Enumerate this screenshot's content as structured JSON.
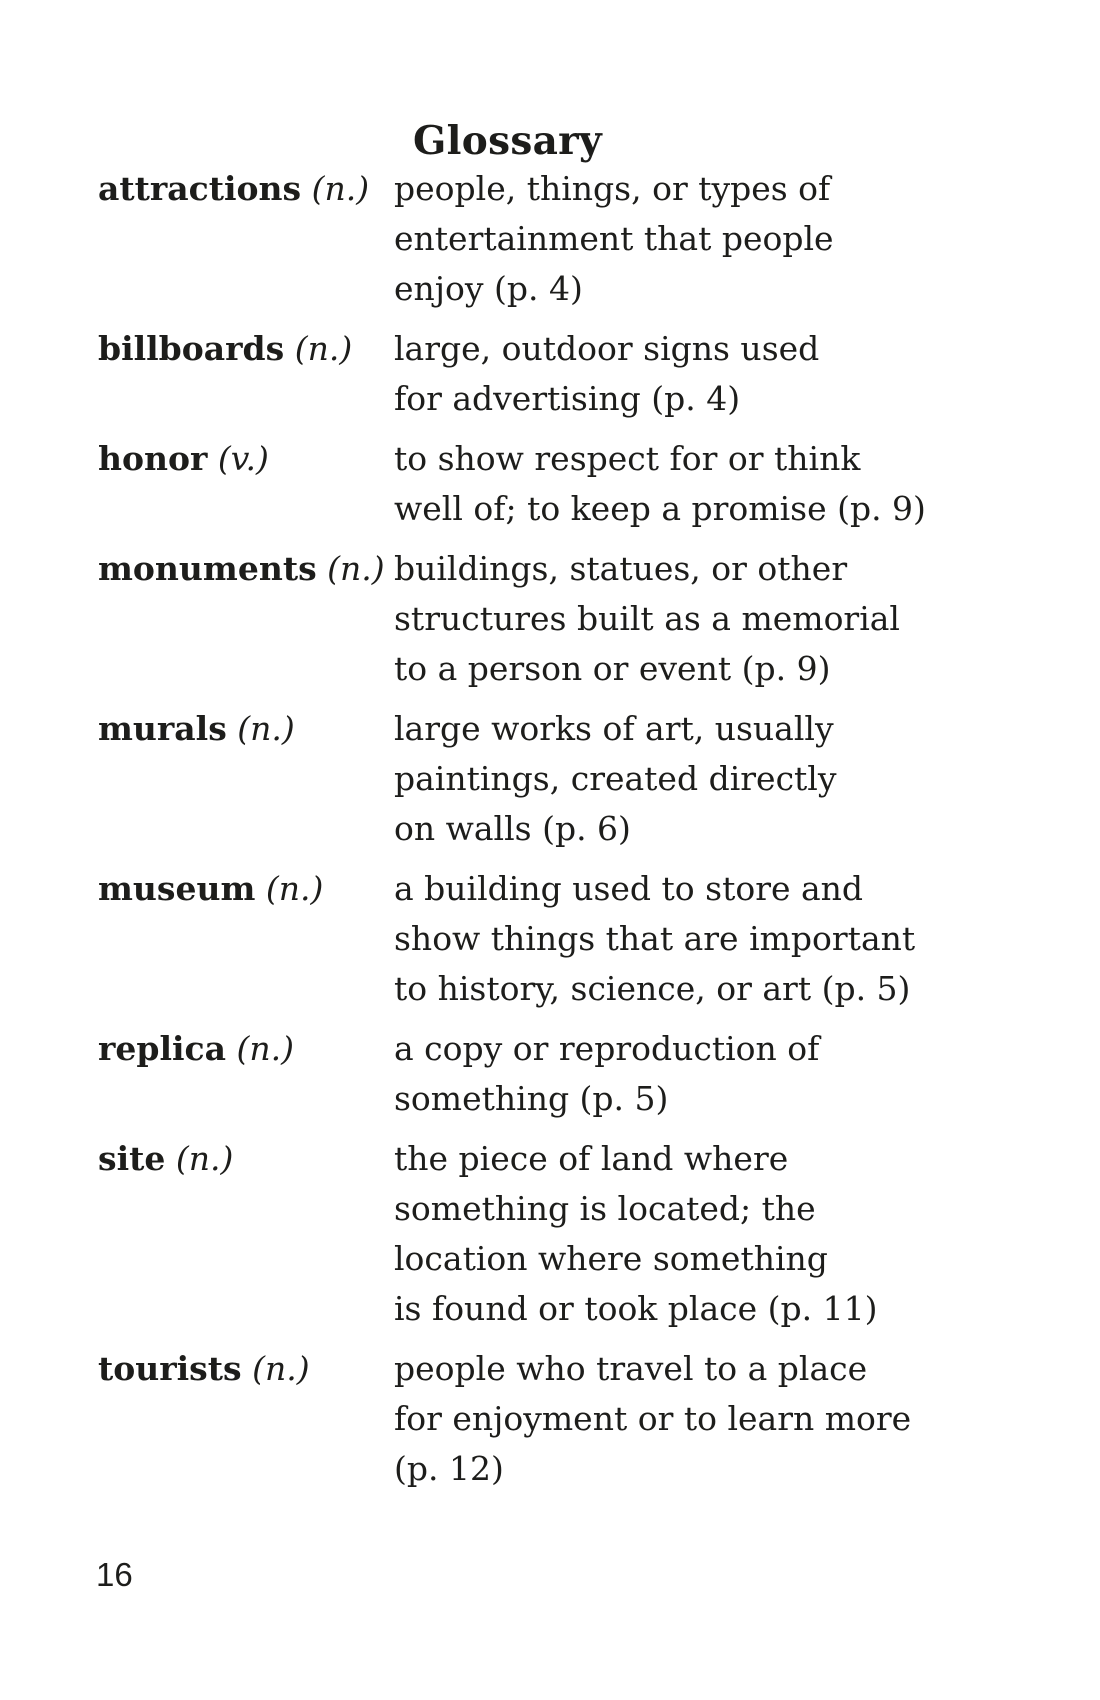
{
  "page": {
    "title": "Glossary",
    "page_number": "16"
  },
  "entries": [
    {
      "word": "attractions",
      "pos": "(n.)",
      "lines": [
        "people, things, or types of",
        "entertainment that people",
        "enjoy (p. 4)"
      ]
    },
    {
      "word": "billboards",
      "pos": "(n.)",
      "lines": [
        "large, outdoor signs used",
        "for advertising (p. 4)"
      ]
    },
    {
      "word": "honor",
      "pos": "(v.)",
      "lines": [
        "to show respect for or think",
        "well of; to keep a promise (p. 9)"
      ]
    },
    {
      "word": "monuments",
      "pos": "(n.)",
      "lines": [
        "buildings, statues, or other",
        "structures built as a memorial",
        "to a person or event (p. 9)"
      ]
    },
    {
      "word": "murals",
      "pos": "(n.)",
      "lines": [
        "large works of art, usually",
        "paintings, created directly",
        "on walls (p. 6)"
      ]
    },
    {
      "word": "museum",
      "pos": "(n.)",
      "lines": [
        "a building used to store and",
        "show things that are important",
        "to history, science, or art (p. 5)"
      ]
    },
    {
      "word": "replica",
      "pos": "(n.)",
      "lines": [
        "a copy or reproduction of",
        "something (p. 5)"
      ]
    },
    {
      "word": "site",
      "pos": "(n.)",
      "lines": [
        "the piece of land where",
        "something is located; the",
        "location where something",
        "is found or took place (p. 11)"
      ]
    },
    {
      "word": "tourists",
      "pos": "(n.)",
      "lines": [
        "people who travel to a place",
        "for enjoyment or to learn more",
        "(p. 12)"
      ]
    }
  ]
}
